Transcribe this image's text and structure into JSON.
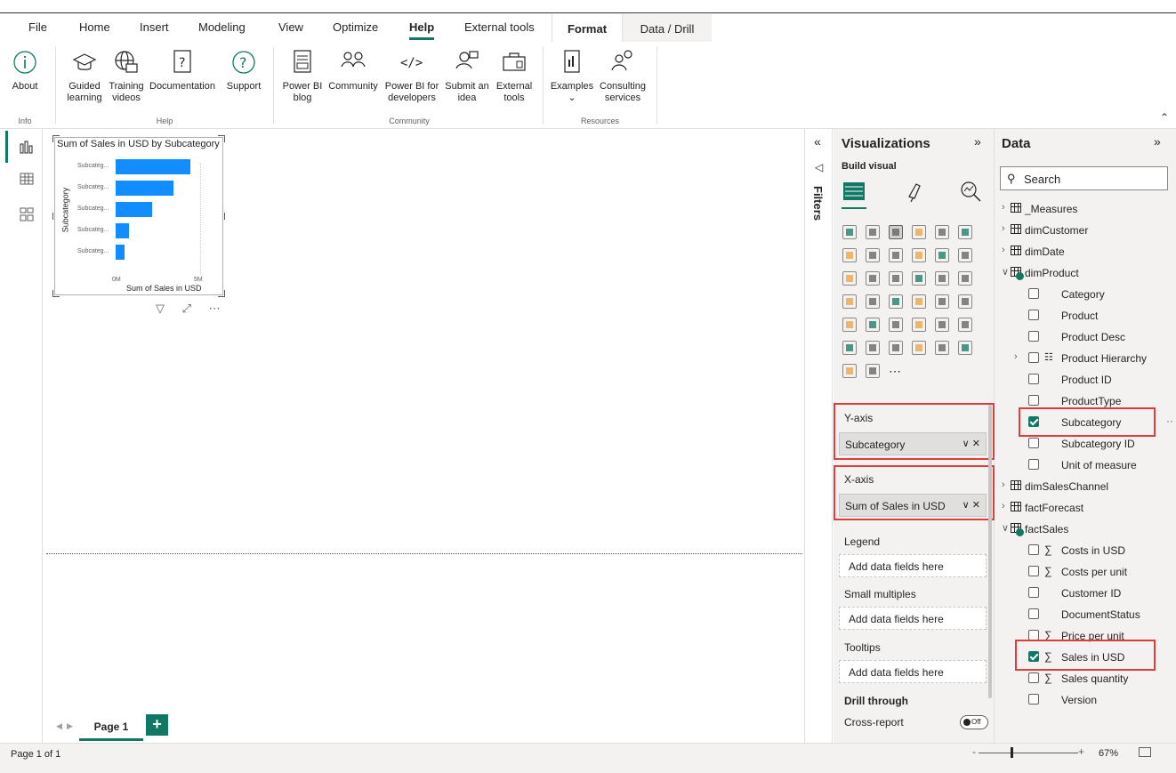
{
  "menu": {
    "file": "File",
    "home": "Home",
    "insert": "Insert",
    "modeling": "Modeling",
    "view": "View",
    "optimize": "Optimize",
    "help": "Help",
    "external_tools": "External tools",
    "format": "Format",
    "data_drill": "Data / Drill"
  },
  "ribbon": {
    "about": "About",
    "guided_learning_1": "Guided",
    "guided_learning_2": "learning",
    "training_1": "Training",
    "training_2": "videos",
    "documentation": "Documentation",
    "support": "Support",
    "blog_1": "Power BI",
    "blog_2": "blog",
    "community": "Community",
    "developers_1": "Power BI for",
    "developers_2": "developers",
    "submit_1": "Submit an",
    "submit_2": "idea",
    "external_1": "External",
    "external_2": "tools",
    "examples": "Examples",
    "examples_chev": "⌄",
    "consulting_1": "Consulting",
    "consulting_2": "services",
    "group_info": "Info",
    "group_help": "Help",
    "group_community": "Community",
    "group_resources": "Resources"
  },
  "visual": {
    "title": "Sum of Sales in USD by Subcategory",
    "y_axis_title": "Subcategory",
    "x_axis_title": "Sum of Sales in USD",
    "toolbar": "▽ ⤢ ⋯"
  },
  "chart_data": {
    "type": "bar",
    "orientation": "horizontal",
    "title": "Sum of Sales in USD by Subcategory",
    "xlabel": "Sum of Sales in USD",
    "ylabel": "Subcategory",
    "categories": [
      "Subcateg...",
      "Subcateg...",
      "Subcateg...",
      "Subcateg...",
      "Subcateg..."
    ],
    "values": [
      4.4,
      3.4,
      2.15,
      0.8,
      0.55
    ],
    "xlim": [
      0,
      5
    ],
    "x_ticks": [
      "0M",
      "5M"
    ],
    "color": "#118dff"
  },
  "pages": {
    "prev": "◀",
    "next": "▶",
    "tab_label": "Page 1",
    "add": "+"
  },
  "status": {
    "page_info": "Page 1 of 1",
    "zoom_minus": "-",
    "zoom_plus": "+",
    "zoom_level": "67%"
  },
  "filters": {
    "label": "Filters",
    "collapse": "«"
  },
  "viz_pane": {
    "title": "Visualizations",
    "expand": "»",
    "build_visual": "Build visual",
    "wells": [
      {
        "label": "Y-axis",
        "field": "Subcategory"
      },
      {
        "label": "X-axis",
        "field": "Sum of Sales in USD"
      },
      {
        "label": "Legend",
        "placeholder": "Add data fields here"
      },
      {
        "label": "Small multiples",
        "placeholder": "Add data fields here"
      },
      {
        "label": "Tooltips",
        "placeholder": "Add data fields here"
      }
    ],
    "field_actions": "∨ ✕",
    "drill_through": "Drill through",
    "cross_report": "Cross-report",
    "cross_report_toggle": "Off",
    "more_visuals": "⋯",
    "accent": "#117865"
  },
  "data_pane": {
    "title": "Data",
    "expand": "»",
    "search_placeholder": "Search",
    "tables": [
      {
        "name": "_Measures",
        "expanded": false
      },
      {
        "name": "dimCustomer",
        "expanded": false
      },
      {
        "name": "dimDate",
        "expanded": false
      },
      {
        "name": "dimProduct",
        "expanded": true
      },
      {
        "name": "dimSalesChannel",
        "expanded": false
      },
      {
        "name": "factForecast",
        "expanded": false
      },
      {
        "name": "factSales",
        "expanded": true
      }
    ],
    "product_fields": [
      {
        "name": "Category",
        "checked": false
      },
      {
        "name": "Product",
        "checked": false
      },
      {
        "name": "Product Desc",
        "checked": false
      },
      {
        "name": "Product Hierarchy",
        "checked": false
      },
      {
        "name": "Product ID",
        "checked": false
      },
      {
        "name": "ProductType",
        "checked": false
      },
      {
        "name": "Subcategory",
        "checked": true
      },
      {
        "name": "Subcategory ID",
        "checked": false
      },
      {
        "name": "Unit of measure",
        "checked": false
      }
    ],
    "sales_fields": [
      {
        "name": "Costs in USD",
        "checked": false
      },
      {
        "name": "Costs per unit",
        "checked": false
      },
      {
        "name": "Customer ID",
        "checked": false
      },
      {
        "name": "DocumentStatus",
        "checked": false
      },
      {
        "name": "Price per unit",
        "checked": false
      },
      {
        "name": "Sales in USD",
        "checked": true
      },
      {
        "name": "Sales quantity",
        "checked": false
      },
      {
        "name": "Version",
        "checked": false
      }
    ],
    "more": "··"
  }
}
